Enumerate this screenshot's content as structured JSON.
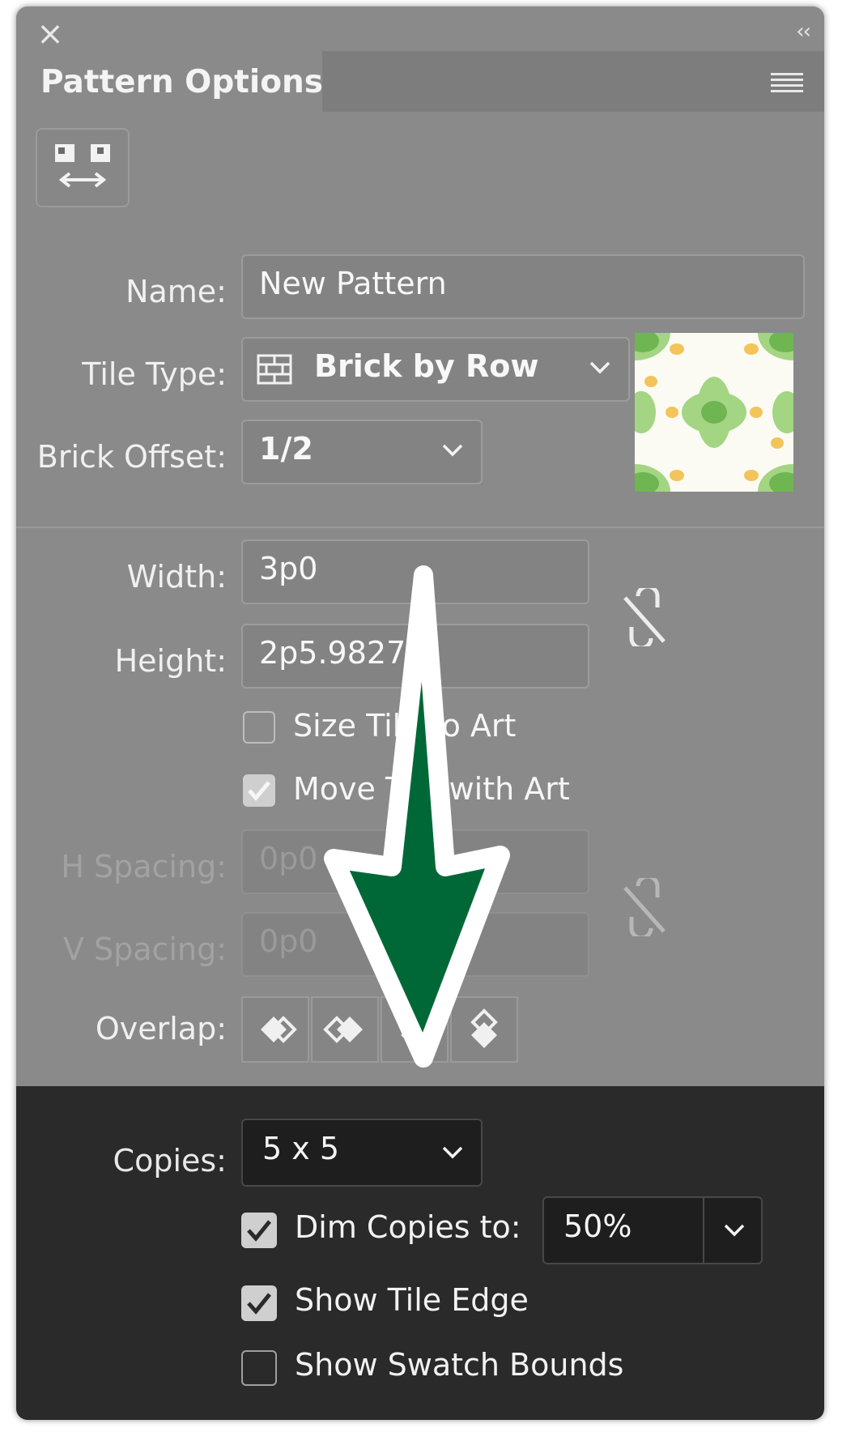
{
  "panel": {
    "title": "Pattern Options",
    "close_glyph": "×",
    "collapse_glyph": "‹‹"
  },
  "fields": {
    "name_label": "Name:",
    "name_value": "New Pattern",
    "tile_type_label": "Tile Type:",
    "tile_type_value": "Brick by Row",
    "brick_offset_label": "Brick Offset:",
    "brick_offset_value": "1/2",
    "width_label": "Width:",
    "width_value": "3p0",
    "height_label": "Height:",
    "height_value": "2p5.9827",
    "size_tile_label": "Size Tile to Art",
    "size_tile_checked": false,
    "move_tile_label": "Move Tile with Art",
    "move_tile_checked": true,
    "h_spacing_label": "H Spacing:",
    "h_spacing_value": "0p0",
    "v_spacing_label": "V Spacing:",
    "v_spacing_value": "0p0",
    "overlap_label": "Overlap:"
  },
  "bottom": {
    "copies_label": "Copies:",
    "copies_value": "5 x 5",
    "dim_copies_label": "Dim Copies to:",
    "dim_copies_checked": true,
    "dim_copies_value": "50%",
    "show_tile_edge_label": "Show Tile Edge",
    "show_tile_edge_checked": true,
    "show_swatch_bounds_label": "Show Swatch Bounds",
    "show_swatch_bounds_checked": false
  },
  "colors": {
    "panel_bg": "#8a8a8a",
    "bottom_bg": "#2a2a2a",
    "arrow_fill": "#006837",
    "arrow_outline": "#ffffff"
  },
  "icons": [
    "close-icon",
    "collapse-icon",
    "panel-menu-icon",
    "tile-edit-icon",
    "brick-tile-icon",
    "chevron-down-icon",
    "link-broken-icon",
    "overlap-icon",
    "checkmark-icon",
    "arrow-down-annotation"
  ]
}
